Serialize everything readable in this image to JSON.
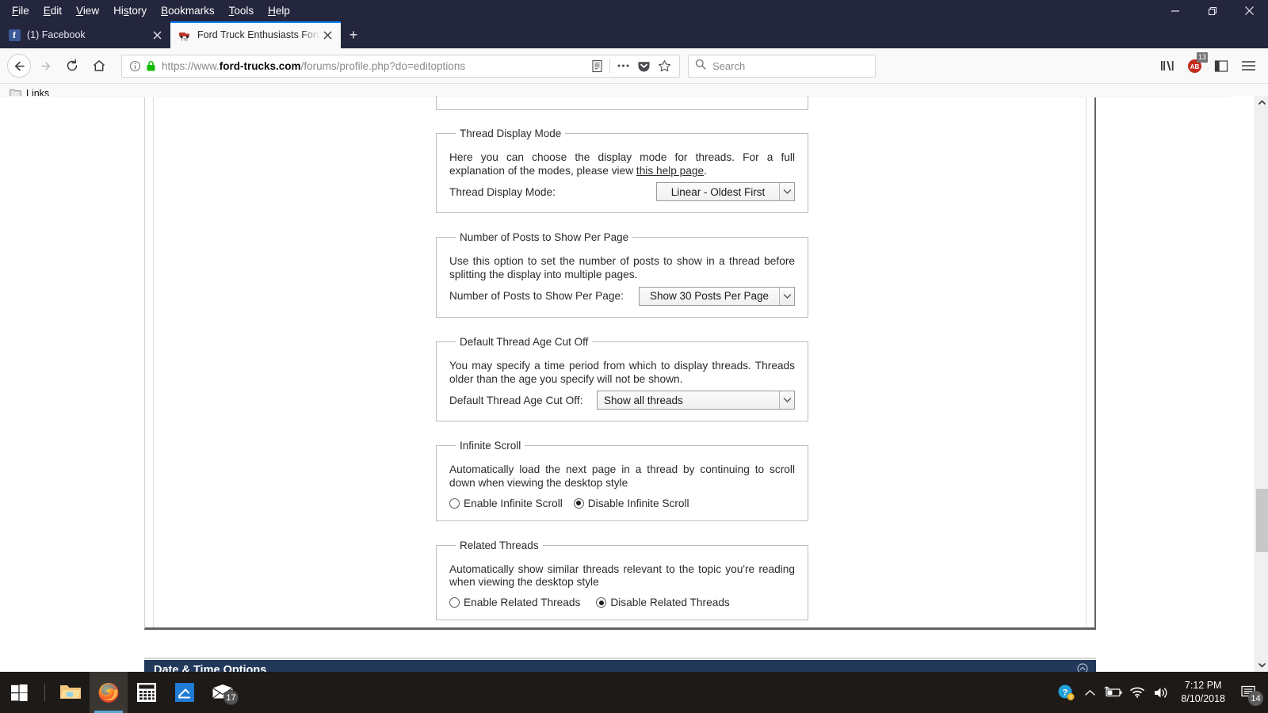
{
  "browser": {
    "menu_items": [
      "File",
      "Edit",
      "View",
      "History",
      "Bookmarks",
      "Tools",
      "Help"
    ],
    "window_controls": {
      "minimize": "minimize-icon",
      "maximize": "restore-icon",
      "close": "close-icon"
    },
    "tabs": [
      {
        "title": "(1) Facebook",
        "favicon": "facebook-icon",
        "active": false
      },
      {
        "title": "Ford Truck Enthusiasts Forums",
        "favicon": "fte-truck-icon",
        "active": true
      }
    ],
    "new_tab_label": "+",
    "toolbar": {
      "back": "back-icon",
      "forward": "forward-icon",
      "reload": "reload-icon",
      "home": "home-icon",
      "library": "library-icon",
      "sidebar": "sidebar-icon",
      "menu": "hamburger-menu-icon",
      "pocket_badge": "13"
    },
    "url": {
      "scheme": "https://www.",
      "host": "ford-trucks.com",
      "path": "/forums/profile.php?do=editoptions",
      "full": "https://www.ford-trucks.com/forums/profile.php?do=editoptions"
    },
    "search": {
      "placeholder": "Search",
      "value": ""
    },
    "bookmarks": [
      {
        "label": "Links",
        "icon": "folder-icon"
      }
    ]
  },
  "page": {
    "sections": [
      {
        "legend": "Thread Display Mode",
        "description_before_link": "Here you can choose the display mode for threads. For a full explanation of the modes, please view ",
        "link_text": "this help page",
        "description_after_link": ".",
        "field_label": "Thread Display Mode:",
        "select_value": "Linear - Oldest First"
      },
      {
        "legend": "Number of Posts to Show Per Page",
        "description": "Use this option to set the number of posts to show in a thread before splitting the display into multiple pages.",
        "field_label": "Number of Posts to Show Per Page:",
        "select_value": "Show 30 Posts Per Page"
      },
      {
        "legend": "Default Thread Age Cut Off",
        "description": "You may specify a time period from which to display threads. Threads older than the age you specify will not be shown.",
        "field_label": "Default Thread Age Cut Off:",
        "select_value": "Show all threads"
      },
      {
        "legend": "Infinite Scroll",
        "description": "Automatically load the next page in a thread by continuing to scroll down when viewing the desktop style",
        "radios": [
          {
            "label": "Enable Infinite Scroll",
            "selected": false
          },
          {
            "label": "Disable Infinite Scroll",
            "selected": true
          }
        ]
      },
      {
        "legend": "Related Threads",
        "description": "Automatically show similar threads relevant to the topic you're reading when viewing the desktop style",
        "radios": [
          {
            "label": "Enable Related Threads",
            "selected": false
          },
          {
            "label": "Disable Related Threads",
            "selected": true
          }
        ]
      }
    ],
    "next_panel": {
      "title": "Date & Time Options",
      "collapse_icon": "collapse-icon"
    }
  },
  "taskbar": {
    "start": "windows-start-icon",
    "apps": [
      {
        "name": "file-explorer-icon",
        "running": false,
        "badge": ""
      },
      {
        "name": "firefox-icon",
        "running": true,
        "badge": ""
      },
      {
        "name": "calculator-icon",
        "running": false,
        "badge": ""
      },
      {
        "name": "snipping-tool-icon",
        "running": false,
        "badge": ""
      },
      {
        "name": "mail-icon",
        "running": false,
        "badge": "17"
      }
    ],
    "tray": {
      "help_icon": "help-icon",
      "show_hidden_icon": "chevron-up-icon",
      "battery_icon": "battery-charging-icon",
      "network_icon": "wifi-icon",
      "volume_icon": "speaker-icon",
      "time": "7:12 PM",
      "date": "8/10/2018",
      "action_center_icon": "action-center-icon",
      "action_center_badge": "14"
    }
  },
  "colors": {
    "chrome_dark": "#23263d",
    "tab_active_bg": "#f9f9fa",
    "tab_accent": "#0a84ff",
    "panel_blue": "#23395b",
    "taskbar": "#1d1a18",
    "lock_green": "#12bc00"
  }
}
